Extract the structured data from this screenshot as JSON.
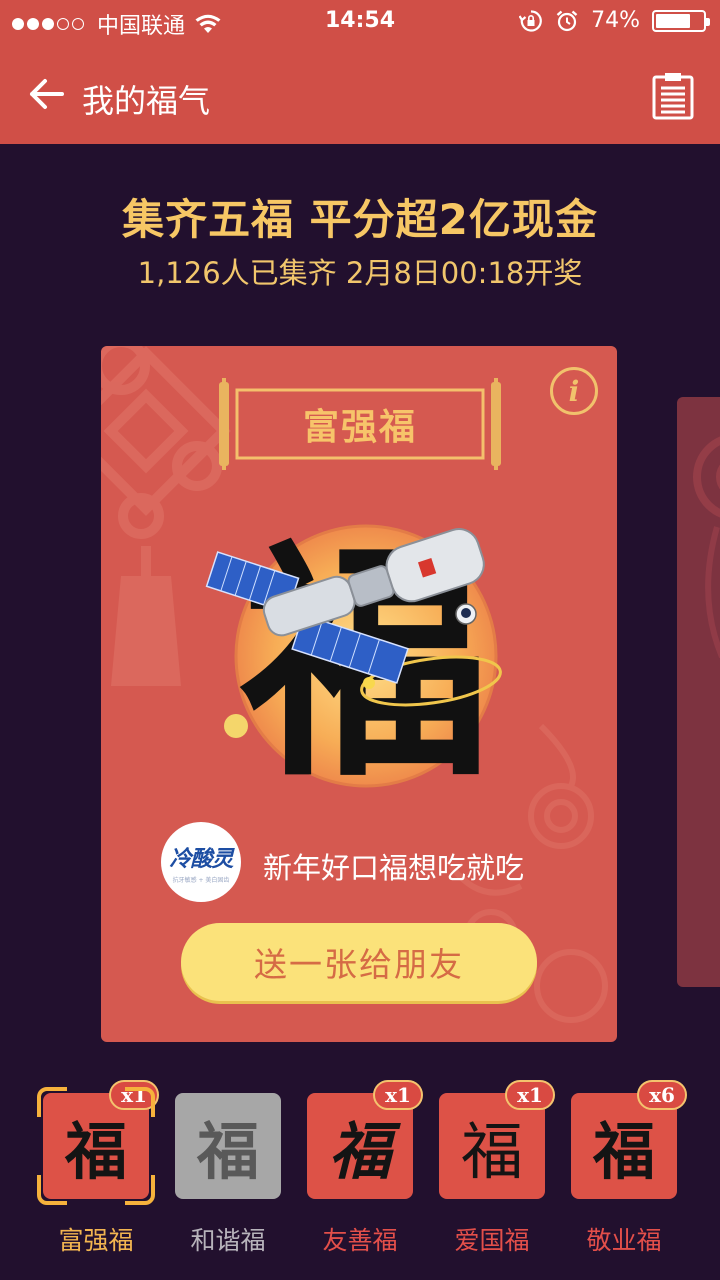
{
  "status_bar": {
    "carrier": "中国联通",
    "time": "14:54",
    "battery": "74%",
    "battery_level": 0.74,
    "signal_strength": 3,
    "signal_max": 5
  },
  "nav": {
    "title": "我的福气",
    "back_icon": "arrow-left-icon",
    "list_icon": "clipboard-list-icon"
  },
  "header": {
    "headline": "集齐五福 平分超2亿现金",
    "subline": "1,126人已集齐 2月8日00:18开奖"
  },
  "card": {
    "name": "富强福",
    "info_label": "i",
    "sponsor_logo_text": "冷酸灵",
    "sponsor_logo_sub": "抗牙敏感 + 美白固齿",
    "sponsor_text": "新年好口福想吃就吃",
    "send_button": "送一张给朋友",
    "glyph": "福"
  },
  "tray": [
    {
      "label": "富强福",
      "glyph": "福",
      "count": "x1",
      "state": "selected"
    },
    {
      "label": "和谐福",
      "glyph": "福",
      "count": "",
      "state": "missing"
    },
    {
      "label": "友善福",
      "glyph": "福",
      "count": "x1",
      "state": "owned"
    },
    {
      "label": "爱国福",
      "glyph": "福",
      "count": "x1",
      "state": "owned"
    },
    {
      "label": "敬业福",
      "glyph": "福",
      "count": "x6",
      "state": "owned"
    }
  ],
  "colors": {
    "header_red": "#d04f47",
    "background": "#22102e",
    "gold": "#f7c765",
    "card_red": "#d55950",
    "button_yellow": "#fbe27a"
  }
}
